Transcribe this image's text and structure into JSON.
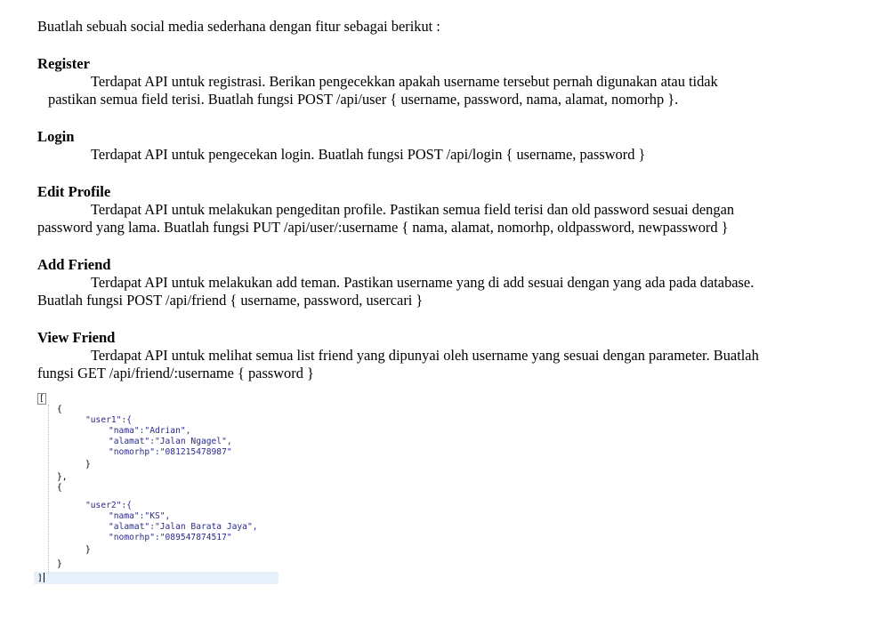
{
  "intro": "Buatlah sebuah social media sederhana dengan fitur sebagai berikut :",
  "sections": [
    {
      "title": "Register",
      "line1": "Terdapat API untuk registrasi. Berikan pengecekkan apakah username tersebut pernah digunakan atau tidak",
      "line2": "pastikan semua field terisi. Buatlah fungsi POST /api/user { username, password, nama, alamat, nomorhp }."
    },
    {
      "title": "Login",
      "line1": "Terdapat API untuk pengecekan login. Buatlah fungsi POST /api/login { username, password }"
    },
    {
      "title": "Edit Profile",
      "line1": "Terdapat API untuk  melakukan pengeditan profile. Pastikan semua field terisi dan old password sesuai dengan",
      "line2": "password yang lama. Buatlah fungsi PUT /api/user/:username { nama, alamat, nomorhp, oldpassword, newpassword }"
    },
    {
      "title": "Add Friend",
      "line1": "Terdapat API untuk melakukan add teman. Pastikan username yang di add sesuai dengan yang ada pada database.",
      "line2": "Buatlah fungsi POST /api/friend { username, password, usercari }"
    },
    {
      "title": "View Friend",
      "line1": "Terdapat API untuk melihat semua list friend yang dipunyai oleh username yang sesuai dengan parameter. Buatlah",
      "line2": "fungsi GET /api/friend/:username { password }"
    }
  ],
  "code": {
    "open_bracket": "[",
    "close_bracket": "]",
    "open_brace": "{",
    "close_brace": "}",
    "close_brace_comma": "},",
    "user1_key": "\"user1\":{",
    "user1_nama": "\"nama\":\"Adrian\",",
    "user1_alamat": "\"alamat\":\"Jalan Ngagel\",",
    "user1_nomorhp": "\"nomorhp\":\"081215478987\"",
    "user2_key": "\"user2\":{",
    "user2_nama": "\"nama\":\"KS\",",
    "user2_alamat": "\"alamat\":\"Jalan Barata Jaya\",",
    "user2_nomorhp": "\"nomorhp\":\"089547874517\""
  }
}
